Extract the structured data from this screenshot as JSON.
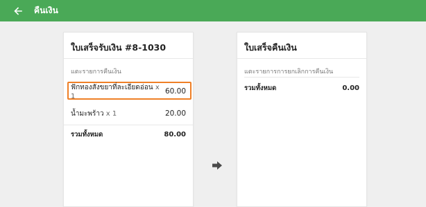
{
  "header": {
    "title": "คืนเงิน",
    "back_icon": "arrow-left-icon"
  },
  "receipt": {
    "title": "ใบเสร็จรับเงิน #8-1030",
    "subtitle": "แตะรายการคืนเงิน",
    "items": [
      {
        "name": "ฟักทองสังขยาที่ละเอียดอ่อน",
        "qty": "x 1",
        "amount": "60.00"
      },
      {
        "name": "น้ำมะพร้าว",
        "qty": "x 1",
        "amount": "20.00"
      }
    ],
    "total_label": "รวมทั้งหมด",
    "total_amount": "80.00"
  },
  "refund": {
    "title": "ใบเสร็จคืนเงิน",
    "subtitle": "แตะรายการการยกเลิกการคืนเงิน",
    "total_label": "รวมทั้งหมด",
    "total_amount": "0.00"
  },
  "colors": {
    "appbar": "#4aa957",
    "highlight": "#ef7f26"
  },
  "icons": {
    "transfer": "arrow-right-icon"
  }
}
